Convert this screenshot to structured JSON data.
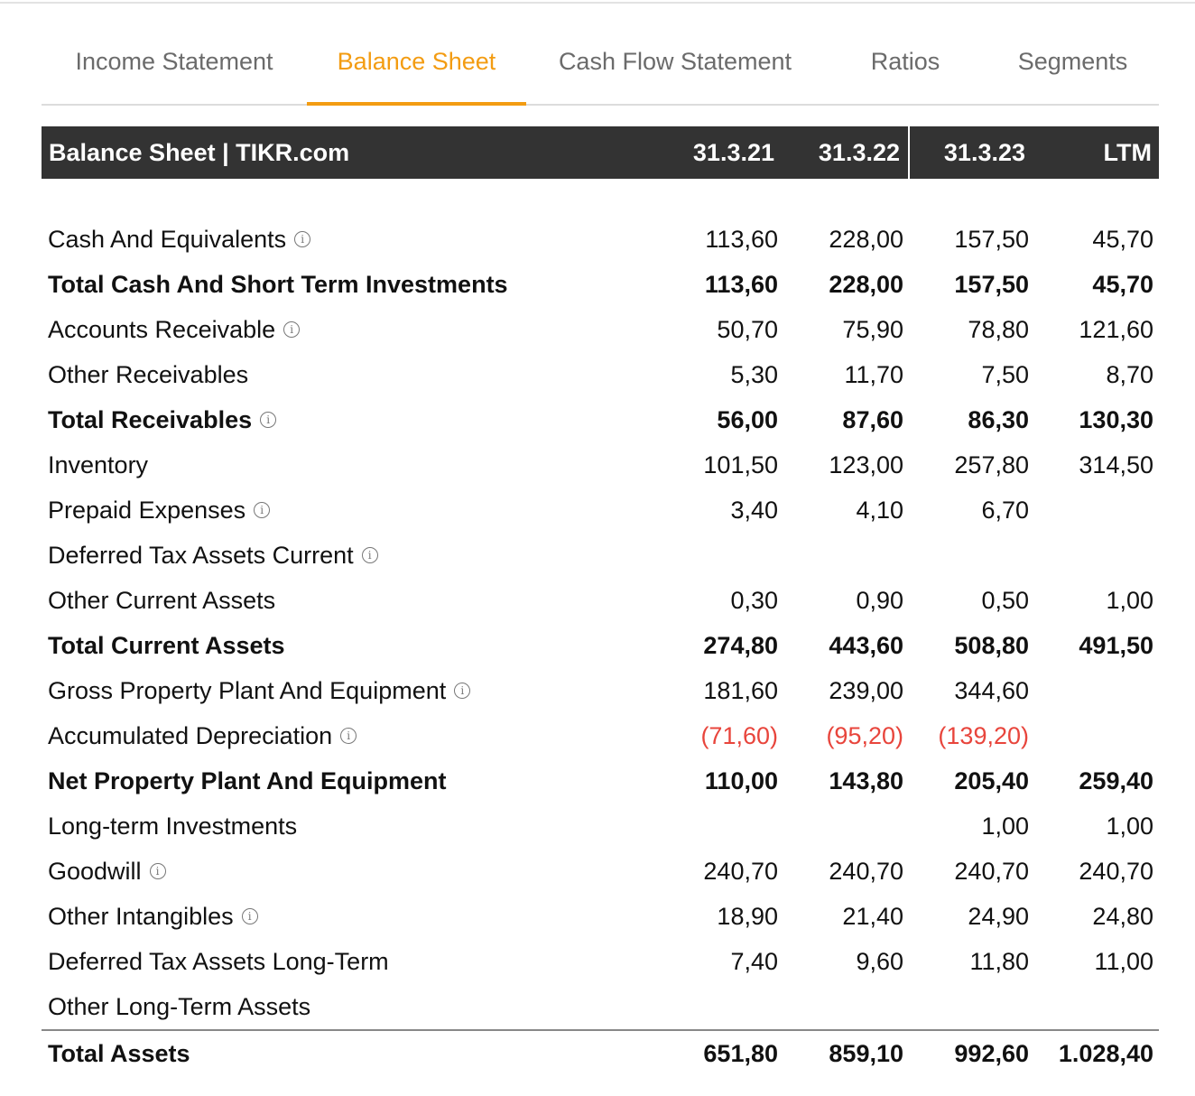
{
  "tabs": [
    {
      "label": "Income Statement",
      "active": false
    },
    {
      "label": "Balance Sheet",
      "active": true
    },
    {
      "label": "Cash Flow Statement",
      "active": false
    },
    {
      "label": "Ratios",
      "active": false
    },
    {
      "label": "Segments",
      "active": false
    }
  ],
  "colors": {
    "accent": "#f39c12",
    "header_bg": "#333333",
    "negative": "#e8453c"
  },
  "table": {
    "title": "Balance Sheet | TIKR.com",
    "columns": [
      "31.3.21",
      "31.3.22",
      "31.3.23",
      "LTM"
    ],
    "rows": [
      {
        "label": "Cash And Equivalents",
        "info": true,
        "bold": false,
        "values": [
          "113,60",
          "228,00",
          "157,50",
          "45,70"
        ]
      },
      {
        "label": "Total Cash And Short Term Investments",
        "info": false,
        "bold": true,
        "values": [
          "113,60",
          "228,00",
          "157,50",
          "45,70"
        ]
      },
      {
        "label": "Accounts Receivable",
        "info": true,
        "bold": false,
        "values": [
          "50,70",
          "75,90",
          "78,80",
          "121,60"
        ]
      },
      {
        "label": "Other Receivables",
        "info": false,
        "bold": false,
        "values": [
          "5,30",
          "11,70",
          "7,50",
          "8,70"
        ]
      },
      {
        "label": "Total Receivables",
        "info": true,
        "bold": true,
        "values": [
          "56,00",
          "87,60",
          "86,30",
          "130,30"
        ]
      },
      {
        "label": "Inventory",
        "info": false,
        "bold": false,
        "values": [
          "101,50",
          "123,00",
          "257,80",
          "314,50"
        ]
      },
      {
        "label": "Prepaid Expenses",
        "info": true,
        "bold": false,
        "values": [
          "3,40",
          "4,10",
          "6,70",
          ""
        ]
      },
      {
        "label": "Deferred Tax Assets Current",
        "info": true,
        "bold": false,
        "values": [
          "",
          "",
          "",
          ""
        ]
      },
      {
        "label": "Other Current Assets",
        "info": false,
        "bold": false,
        "values": [
          "0,30",
          "0,90",
          "0,50",
          "1,00"
        ]
      },
      {
        "label": "Total Current Assets",
        "info": false,
        "bold": true,
        "values": [
          "274,80",
          "443,60",
          "508,80",
          "491,50"
        ]
      },
      {
        "label": "Gross Property Plant And Equipment",
        "info": true,
        "bold": false,
        "values": [
          "181,60",
          "239,00",
          "344,60",
          ""
        ]
      },
      {
        "label": "Accumulated Depreciation",
        "info": true,
        "bold": false,
        "values": [
          "(71,60)",
          "(95,20)",
          "(139,20)",
          ""
        ]
      },
      {
        "label": "Net Property Plant And Equipment",
        "info": false,
        "bold": true,
        "values": [
          "110,00",
          "143,80",
          "205,40",
          "259,40"
        ]
      },
      {
        "label": "Long-term Investments",
        "info": false,
        "bold": false,
        "values": [
          "",
          "",
          "1,00",
          "1,00"
        ]
      },
      {
        "label": "Goodwill",
        "info": true,
        "bold": false,
        "values": [
          "240,70",
          "240,70",
          "240,70",
          "240,70"
        ]
      },
      {
        "label": "Other Intangibles",
        "info": true,
        "bold": false,
        "values": [
          "18,90",
          "21,40",
          "24,90",
          "24,80"
        ]
      },
      {
        "label": "Deferred Tax Assets Long-Term",
        "info": false,
        "bold": false,
        "values": [
          "7,40",
          "9,60",
          "11,80",
          "11,00"
        ]
      },
      {
        "label": "Other Long-Term Assets",
        "info": false,
        "bold": false,
        "values": [
          "",
          "",
          "",
          ""
        ]
      }
    ],
    "total": {
      "label": "Total Assets",
      "values": [
        "651,80",
        "859,10",
        "992,60",
        "1.028,40"
      ]
    }
  },
  "icons": {
    "info": "info-icon",
    "info_glyph": "i"
  }
}
